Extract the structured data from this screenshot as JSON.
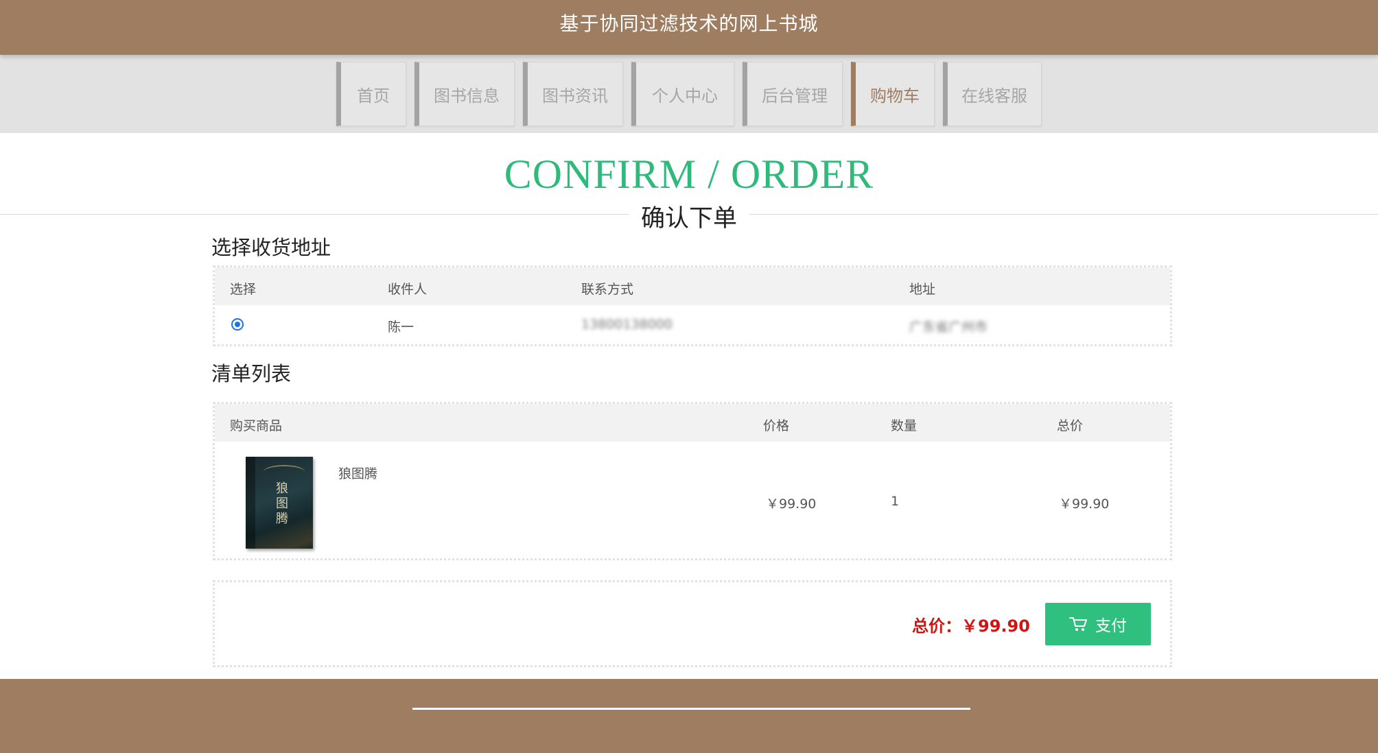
{
  "site": {
    "title": "基于协同过滤技术的网上书城"
  },
  "nav": {
    "items": [
      {
        "label": "首页"
      },
      {
        "label": "图书信息"
      },
      {
        "label": "图书资讯"
      },
      {
        "label": "个人中心"
      },
      {
        "label": "后台管理"
      },
      {
        "label": "购物车",
        "active": true
      },
      {
        "label": "在线客服"
      }
    ]
  },
  "page": {
    "title": "CONFIRM / ORDER",
    "subtitle": "确认下单"
  },
  "address_section": {
    "heading": "选择收货地址",
    "columns": [
      "选择",
      "收件人",
      "联系方式",
      "地址"
    ],
    "rows": [
      {
        "selected": true,
        "recipient": "陈一",
        "phone": "13800138000",
        "address": "广东省广州市"
      }
    ]
  },
  "order_section": {
    "heading": "清单列表",
    "columns": [
      "购买商品",
      "价格",
      "数量",
      "总价"
    ],
    "items": [
      {
        "name": "狼图腾",
        "price": "￥99.90",
        "quantity": "1",
        "total": "￥99.90",
        "cover_text": "狼图腾"
      }
    ]
  },
  "summary": {
    "total_label": "总价：",
    "total_value": "￥99.90",
    "pay_label": "支付",
    "pay_icon": "cart-icon"
  },
  "colors": {
    "brand": "#9e7d61",
    "accent": "#2fb97a",
    "price": "#d01414",
    "radio": "#1a73e8"
  }
}
